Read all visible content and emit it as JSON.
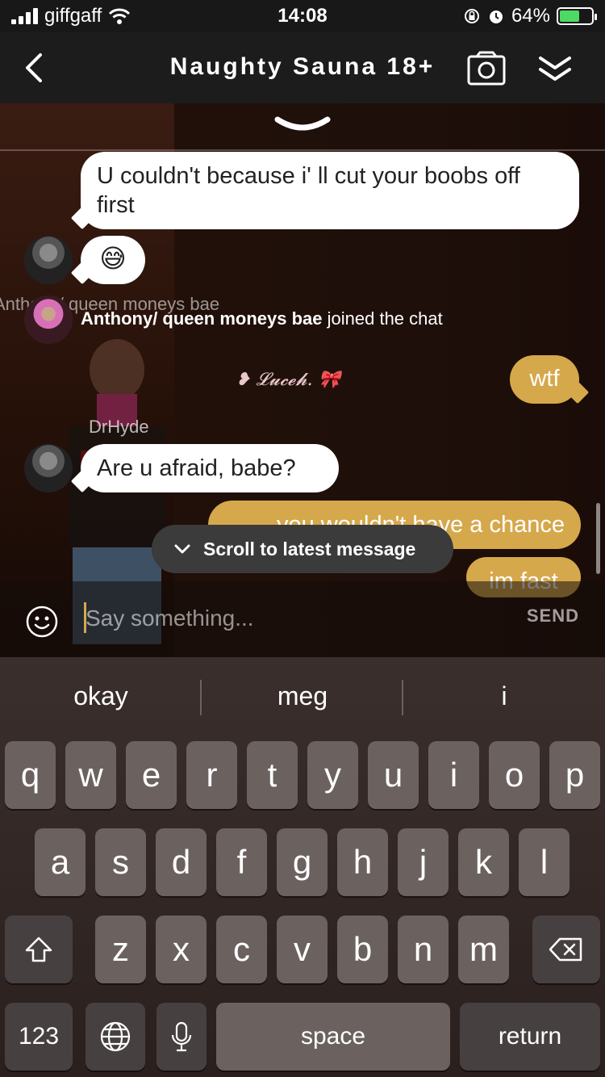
{
  "status_bar": {
    "carrier": "giffgaff",
    "time": "14:08",
    "battery_percent": "64%",
    "battery_level": 0.64
  },
  "nav": {
    "title": "Naughty Sauna 18+"
  },
  "messages": [
    {
      "text": "U couldn't because i' ll cut your boobs off first",
      "side": "left"
    },
    {
      "text": "😅",
      "side": "left"
    },
    {
      "text": "wtf",
      "side": "right"
    },
    {
      "text": "Are u afraid, babe?",
      "side": "left"
    },
    {
      "text": "you wouldn't have a chance",
      "side": "right"
    },
    {
      "text": "im fast",
      "side": "right"
    }
  ],
  "system_message": {
    "ghost_name": "Anthony/ queen moneys bae",
    "user": "Anthony/ queen moneys bae",
    "action": "joined the chat"
  },
  "overlay": {
    "sticker_text": "❥ 𝓛𝓾𝓬𝓮𝓱. 🎀",
    "sender_label": "DrHyde"
  },
  "scroll_pill": {
    "label": "Scroll to latest message"
  },
  "input": {
    "placeholder": "Say something...",
    "send_label": "SEND"
  },
  "keyboard": {
    "suggestions": [
      "okay",
      "meg",
      "i"
    ],
    "row1": [
      "q",
      "w",
      "e",
      "r",
      "t",
      "y",
      "u",
      "i",
      "o",
      "p"
    ],
    "row2": [
      "a",
      "s",
      "d",
      "f",
      "g",
      "h",
      "j",
      "k",
      "l"
    ],
    "row3": [
      "z",
      "x",
      "c",
      "v",
      "b",
      "n",
      "m"
    ],
    "numbers_label": "123",
    "space_label": "space",
    "return_label": "return"
  },
  "colors": {
    "accent": "#d6a84c",
    "battery": "#4cd964",
    "bubble_incoming": "#ffffff"
  }
}
